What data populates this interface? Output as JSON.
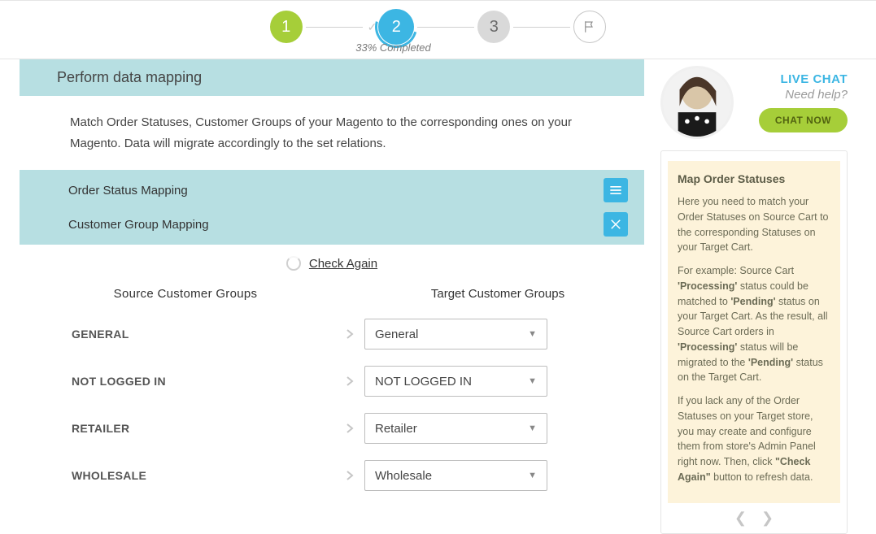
{
  "progress": {
    "label_1": "1",
    "label_2": "2",
    "label_3": "3",
    "completed": "33% Completed"
  },
  "header": {
    "title": "Perform data mapping"
  },
  "desc": "Match Order Statuses, Customer Groups of your Magento to the corresponding ones on your Magento. Data will migrate accordingly to the set relations.",
  "tabs": {
    "order": "Order Status Mapping",
    "customer": "Customer Group Mapping"
  },
  "check_again": "Check Again",
  "grid": {
    "source_head": "Source Customer Groups",
    "target_head": "Target Customer Groups",
    "rows": [
      {
        "src": "GENERAL",
        "tgt": "General"
      },
      {
        "src": "NOT LOGGED IN",
        "tgt": "NOT LOGGED IN"
      },
      {
        "src": "RETAILER",
        "tgt": "Retailer"
      },
      {
        "src": "WHOLESALE",
        "tgt": "Wholesale"
      }
    ]
  },
  "chat": {
    "title": "LIVE CHAT",
    "subtitle": "Need help?",
    "button": "CHAT NOW"
  },
  "help": {
    "title": "Map Order Statuses",
    "p1": "Here you need to match your Order Statuses on Source Cart to the corresponding Statuses on your Target Cart.",
    "p2a": "For example: Source Cart ",
    "p2b": "'Processing'",
    "p2c": " status could be matched to ",
    "p2d": "'Pending'",
    "p2e": " status on your Target Cart. As the result, all Source Cart orders in ",
    "p2f": "'Processing'",
    "p2g": " status will be migrated to the ",
    "p2h": "'Pending'",
    "p2i": " status on the Target Cart.",
    "p3a": "If you lack any of the Order Statuses on your Target store, you may create and configure them from store's Admin Panel right now. Then, click ",
    "p3b": "\"Check Again\"",
    "p3c": " button to refresh data."
  }
}
